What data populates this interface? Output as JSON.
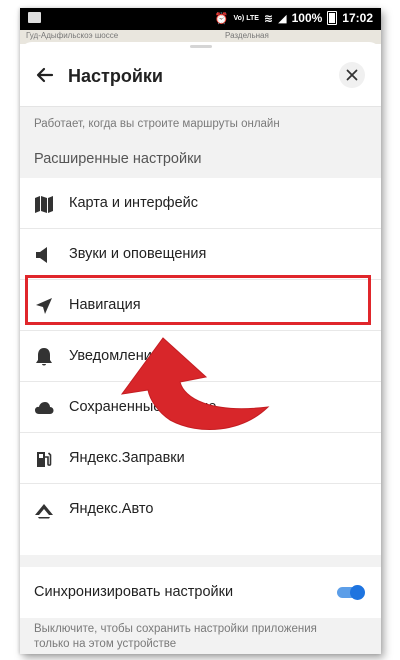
{
  "status_bar": {
    "lte": "Vo) LTE",
    "battery": "100%",
    "time": "17:02"
  },
  "map_strip": {
    "left_text": "Гуд-Адыфильскоэ шоссе",
    "right_text": "Раздельная"
  },
  "header": {
    "title": "Настройки"
  },
  "info_top": "Работает, когда вы строите маршруты онлайн",
  "section_title": "Расширенные настройки",
  "items": [
    {
      "label": "Карта и интерфейс",
      "icon": "map-icon"
    },
    {
      "label": "Звуки и оповещения",
      "icon": "speaker-icon"
    },
    {
      "label": "Навигация",
      "icon": "navigation-arrow-icon"
    },
    {
      "label": "Уведомления",
      "icon": "bell-icon"
    },
    {
      "label": "Сохраненные данные",
      "icon": "cloud-icon"
    },
    {
      "label": "Яндекс.Заправки",
      "icon": "fuel-icon"
    },
    {
      "label": "Яндекс.Авто",
      "icon": "car-icon"
    }
  ],
  "sync": {
    "label": "Синхронизировать настройки",
    "enabled": true
  },
  "info_bottom": "Выключите, чтобы сохранить настройки приложения только на этом устройстве",
  "colors": {
    "highlight": "#e0262b",
    "toggle_accent": "#1e74e0",
    "section_bg": "#f2f2f2"
  }
}
